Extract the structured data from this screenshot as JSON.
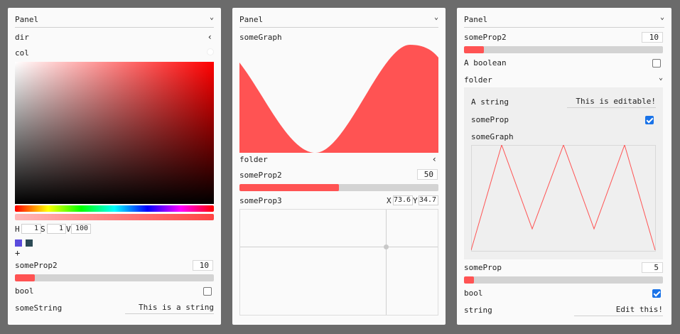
{
  "panel1": {
    "title": "Panel",
    "dir_label": "dir",
    "dir_chevron": "‹",
    "col_label": "col",
    "h_label": "H",
    "h_value": "1",
    "s_label": "S",
    "s_value": "1",
    "v_label": "V",
    "v_value": "100",
    "swatch_colors": [
      "#5a4bdc",
      "#2c4a55"
    ],
    "add_label": "+",
    "someProp2_label": "someProp2",
    "someProp2_value": "10",
    "someProp2_fraction": 0.1,
    "bool_label": "bool",
    "bool_checked": false,
    "someString_label": "someString",
    "someString_value": "This is a string"
  },
  "panel2": {
    "title": "Panel",
    "graph_label": "someGraph",
    "folder_label": "folder",
    "folder_chevron": "‹",
    "someProp2_label": "someProp2",
    "someProp2_value": "50",
    "someProp2_fraction": 0.5,
    "someProp3_label": "someProp3",
    "x_label": "X",
    "x_value": "73.6",
    "y_label": "Y",
    "y_value": "34.7"
  },
  "panel3": {
    "title": "Panel",
    "someProp2_label": "someProp2",
    "someProp2_value": "10",
    "someProp2_fraction": 0.1,
    "aboolean_label": "A boolean",
    "aboolean_checked": false,
    "folder_label": "folder",
    "string_label": "A string",
    "string_value": "This is editable!",
    "someProp_inner_label": "someProp",
    "someProp_inner_checked": true,
    "graph_label": "someGraph",
    "someProp_label": "someProp",
    "someProp_value": "5",
    "someProp_fraction": 0.05,
    "bool_label": "bool",
    "bool_checked": true,
    "string2_label": "string",
    "string2_value": "Edit this!"
  },
  "colors": {
    "accent": "#ff5353",
    "track": "#d3d3d3",
    "check": "#1a73e8"
  }
}
